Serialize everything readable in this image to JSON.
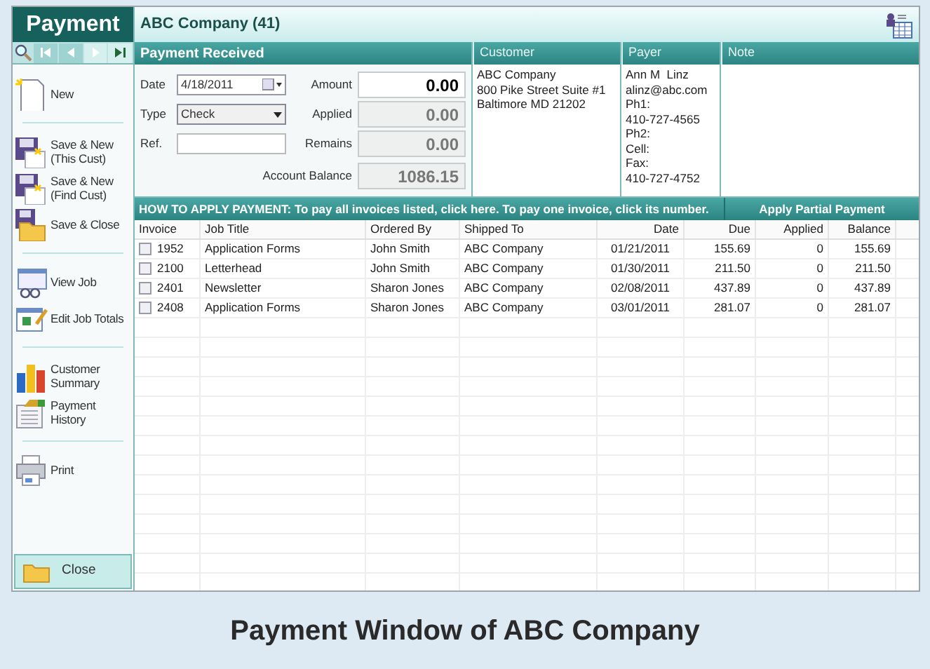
{
  "sidebar": {
    "title": "Payment",
    "groups": [
      [
        {
          "label": "New"
        }
      ],
      [
        {
          "label": "Save & New (This Cust)"
        },
        {
          "label": "Save & New (Find Cust)"
        },
        {
          "label": "Save & Close"
        }
      ],
      [
        {
          "label": "View Job"
        },
        {
          "label": "Edit Job Totals"
        }
      ],
      [
        {
          "label": "Customer Summary"
        },
        {
          "label": "Payment History"
        }
      ],
      [
        {
          "label": "Print"
        }
      ]
    ],
    "close": "Close"
  },
  "header": {
    "title": "ABC Company (41)"
  },
  "payment": {
    "title": "Payment Received",
    "date_label": "Date",
    "date": "4/18/2011",
    "type_label": "Type",
    "type": "Check",
    "ref_label": "Ref.",
    "amounts": [
      {
        "label": "Amount",
        "value": "0.00",
        "editable": true
      },
      {
        "label": "Applied",
        "value": "0.00",
        "editable": false
      },
      {
        "label": "Remains",
        "value": "0.00",
        "editable": false
      },
      {
        "label": "Account Balance",
        "value": "1086.15",
        "editable": false
      }
    ]
  },
  "info_panels": [
    {
      "title": "Customer",
      "lines": [
        "ABC Company",
        "800 Pike Street Suite #1",
        "Baltimore MD 21202"
      ]
    },
    {
      "title": "Payer",
      "lines": [
        "Ann M  Linz",
        "alinz@abc.com",
        "Ph1:",
        "410-727-4565",
        "Ph2:",
        "Cell:",
        "Fax:",
        "410-727-4752"
      ]
    },
    {
      "title": "Note"
    }
  ],
  "instructions": "HOW TO APPLY PAYMENT: To pay all invoices listed, click here. To pay one invoice, click its number.",
  "apply_partial": "Apply Partial Payment",
  "table": {
    "columns": [
      "Invoice",
      "Job Title",
      "Ordered By",
      "Shipped To",
      "Date",
      "Due",
      "Applied",
      "Balance"
    ],
    "rows": [
      {
        "checked": false,
        "cells": [
          "1952",
          "Application Forms",
          "John Smith",
          "ABC Company",
          "01/21/2011",
          "155.69",
          "0",
          "155.69"
        ]
      },
      {
        "checked": false,
        "cells": [
          "2100",
          "Letterhead",
          "John Smith",
          "ABC Company",
          "01/30/2011",
          "211.50",
          "0",
          "211.50"
        ]
      },
      {
        "checked": false,
        "cells": [
          "2401",
          "Newsletter",
          "Sharon Jones",
          "ABC Company",
          "02/08/2011",
          "437.89",
          "0",
          "437.89"
        ]
      },
      {
        "checked": false,
        "cells": [
          "2408",
          "Application Forms",
          "Sharon Jones",
          "ABC Company",
          "03/01/2011",
          "281.07",
          "0",
          "281.07"
        ]
      }
    ]
  },
  "caption": "Payment Window of ABC Company"
}
